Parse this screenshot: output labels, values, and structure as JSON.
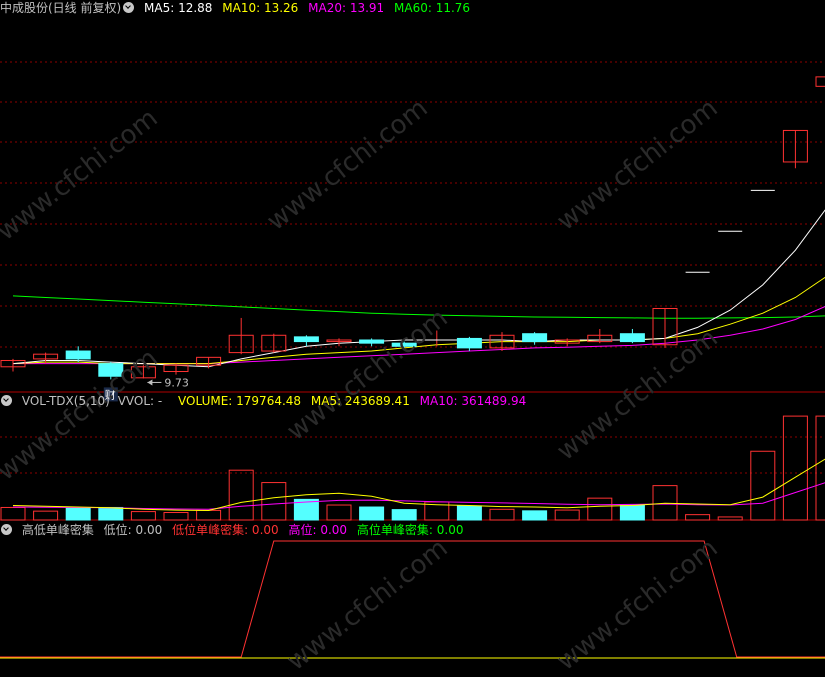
{
  "header_main": {
    "title": "中成股份(日线 前复权)",
    "ma5": "MA5: 12.88",
    "ma10": "MA10: 13.26",
    "ma20": "MA20: 13.91",
    "ma60": "MA60: 11.76"
  },
  "header_vol": {
    "name": "VOL-TDX(5,10)",
    "vvol": "VVOL: -",
    "volume": "VOLUME: 179764.48",
    "ma5": "MA5: 243689.41",
    "ma10": "MA10: 361489.94"
  },
  "header_ind": {
    "name": "高低单峰密集",
    "low": "低位: 0.00",
    "low_peak": "低位单峰密集: 0.00",
    "high": "高位: 0.00",
    "high_peak": "高位单峰密集: 0.00"
  },
  "annotations": {
    "low_label": "9.73",
    "cai": "财"
  },
  "watermark": "www.cfchi.com",
  "colors": {
    "up": "#ff3232",
    "down": "#54ffff",
    "ma5": "#ffffff",
    "ma10": "#ffff00",
    "ma20": "#ff00ff",
    "ma60": "#00ff00",
    "grid": "#8b0000",
    "border": "#b00000"
  },
  "chart_data": {
    "type": "candlestick",
    "price_ylim": [
      9.3,
      21.2
    ],
    "candles": [
      {
        "o": 10.1,
        "h": 10.35,
        "l": 9.95,
        "c": 10.3
      },
      {
        "o": 10.35,
        "h": 10.55,
        "l": 10.2,
        "c": 10.5
      },
      {
        "o": 10.6,
        "h": 10.75,
        "l": 10.25,
        "c": 10.35
      },
      {
        "o": 10.2,
        "h": 10.25,
        "l": 9.7,
        "c": 9.8
      },
      {
        "o": 9.75,
        "h": 10.15,
        "l": 9.73,
        "c": 10.1
      },
      {
        "o": 9.95,
        "h": 10.2,
        "l": 9.85,
        "c": 10.15
      },
      {
        "o": 10.15,
        "h": 10.4,
        "l": 10.05,
        "c": 10.4
      },
      {
        "o": 10.55,
        "h": 11.65,
        "l": 10.5,
        "c": 11.1
      },
      {
        "o": 10.6,
        "h": 11.15,
        "l": 10.55,
        "c": 11.1
      },
      {
        "o": 11.05,
        "h": 11.1,
        "l": 10.75,
        "c": 10.9
      },
      {
        "o": 10.9,
        "h": 11.0,
        "l": 10.75,
        "c": 10.95
      },
      {
        "o": 10.95,
        "h": 11.0,
        "l": 10.75,
        "c": 10.85
      },
      {
        "o": 10.85,
        "h": 10.9,
        "l": 10.7,
        "c": 10.75
      },
      {
        "o": 10.95,
        "h": 11.25,
        "l": 10.75,
        "c": 10.95
      },
      {
        "o": 11.0,
        "h": 11.05,
        "l": 10.6,
        "c": 10.7
      },
      {
        "o": 10.7,
        "h": 11.2,
        "l": 10.6,
        "c": 11.1
      },
      {
        "o": 11.15,
        "h": 11.2,
        "l": 10.8,
        "c": 10.9
      },
      {
        "o": 10.85,
        "h": 11.0,
        "l": 10.75,
        "c": 10.95
      },
      {
        "o": 10.9,
        "h": 11.3,
        "l": 10.85,
        "c": 11.1
      },
      {
        "o": 11.15,
        "h": 11.3,
        "l": 10.85,
        "c": 10.9
      },
      {
        "o": 10.8,
        "h": 11.95,
        "l": 10.7,
        "c": 11.95
      },
      {
        "o": 13.1,
        "h": 13.1,
        "l": 13.1,
        "c": 13.1
      },
      {
        "o": 14.4,
        "h": 14.4,
        "l": 14.4,
        "c": 14.4
      },
      {
        "o": 15.7,
        "h": 15.7,
        "l": 15.7,
        "c": 15.7
      },
      {
        "o": 16.6,
        "h": 17.6,
        "l": 16.4,
        "c": 17.6
      },
      {
        "o": 19.0,
        "h": 20.5,
        "l": 18.7,
        "c": 19.3
      },
      {
        "o": 19.65,
        "h": 21.0,
        "l": 17.8,
        "c": 19.3
      }
    ],
    "ma5": [
      10.2,
      10.3,
      10.3,
      10.25,
      10.2,
      10.15,
      10.1,
      10.35,
      10.55,
      10.75,
      10.85,
      10.9,
      10.95,
      10.95,
      10.95,
      10.95,
      10.9,
      10.95,
      10.95,
      10.95,
      11.0,
      11.35,
      11.9,
      12.7,
      13.8,
      15.2,
      16.7
    ],
    "ma10": [
      10.2,
      10.25,
      10.25,
      10.2,
      10.2,
      10.2,
      10.2,
      10.3,
      10.4,
      10.5,
      10.55,
      10.6,
      10.7,
      10.8,
      10.85,
      10.9,
      10.9,
      10.9,
      10.95,
      10.95,
      11.0,
      11.15,
      11.45,
      11.8,
      12.3,
      13.0,
      13.75
    ],
    "ma20": [
      10.2,
      10.2,
      10.2,
      10.2,
      10.2,
      10.2,
      10.2,
      10.25,
      10.3,
      10.35,
      10.4,
      10.45,
      10.5,
      10.55,
      10.6,
      10.65,
      10.7,
      10.72,
      10.75,
      10.78,
      10.85,
      10.95,
      11.1,
      11.3,
      11.6,
      12.05,
      12.45
    ],
    "ma60": [
      12.35,
      12.3,
      12.25,
      12.2,
      12.15,
      12.1,
      12.05,
      12.0,
      11.95,
      11.9,
      11.85,
      11.8,
      11.77,
      11.74,
      11.72,
      11.7,
      11.68,
      11.67,
      11.66,
      11.65,
      11.64,
      11.64,
      11.65,
      11.66,
      11.68,
      11.72,
      11.76
    ],
    "volume": [
      82000,
      58000,
      78000,
      82000,
      55000,
      49000,
      63000,
      326000,
      245000,
      135000,
      98000,
      85000,
      68000,
      118000,
      92000,
      70000,
      60000,
      65000,
      143000,
      97000,
      225000,
      35000,
      20000,
      450000,
      680000,
      680000,
      620000
    ],
    "vol_ma5": [
      95000,
      90000,
      85000,
      80000,
      70000,
      65000,
      62000,
      115000,
      145000,
      165000,
      175000,
      155000,
      110000,
      100000,
      95000,
      88000,
      85000,
      80000,
      90000,
      95000,
      110000,
      105000,
      100000,
      150000,
      280000,
      410000,
      500000
    ],
    "vol_ma10": [
      85000,
      83000,
      82000,
      80000,
      75000,
      72000,
      70000,
      90000,
      105000,
      118000,
      128000,
      130000,
      125000,
      120000,
      115000,
      112000,
      108000,
      103000,
      100000,
      102000,
      105000,
      100000,
      98000,
      110000,
      180000,
      250000,
      330000
    ],
    "vol_ylim": [
      0,
      720000
    ],
    "indicator": {
      "rise": [
        7.0,
        7.5
      ],
      "top": [
        8.0,
        21.2
      ],
      "fall": [
        21.2,
        22.2
      ],
      "value_high": 1,
      "value_low": 0
    }
  }
}
